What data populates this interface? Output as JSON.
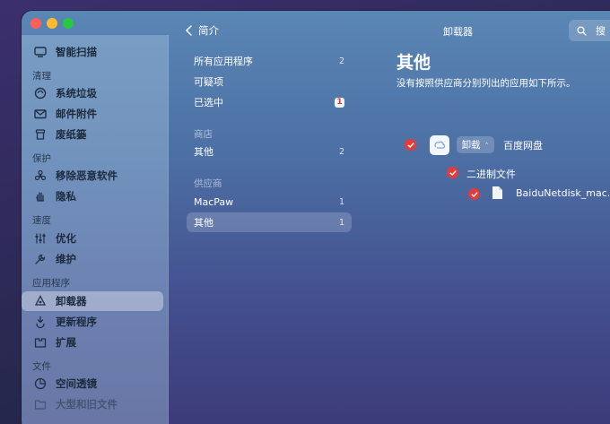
{
  "sidebar": {
    "items": [
      {
        "label": "智能扫描",
        "icon": "monitor-icon"
      },
      {
        "label": "系统垃圾",
        "icon": "trash-cycle-icon"
      },
      {
        "label": "邮件附件",
        "icon": "mail-icon"
      },
      {
        "label": "废纸篓",
        "icon": "trash-bin-icon"
      },
      {
        "label": "移除恶意软件",
        "icon": "biohazard-icon"
      },
      {
        "label": "隐私",
        "icon": "hand-icon"
      },
      {
        "label": "优化",
        "icon": "sliders-icon"
      },
      {
        "label": "维护",
        "icon": "wrench-icon"
      },
      {
        "label": "卸载器",
        "icon": "apps-icon"
      },
      {
        "label": "更新程序",
        "icon": "update-icon"
      },
      {
        "label": "扩展",
        "icon": "extension-icon"
      },
      {
        "label": "空间透镜",
        "icon": "lens-icon"
      },
      {
        "label": "大型和旧文件",
        "icon": "folder-icon"
      }
    ],
    "sections": [
      "清理",
      "保护",
      "速度",
      "应用程序",
      "文件"
    ]
  },
  "middle": {
    "back_label": "简介",
    "items": [
      {
        "label": "所有应用程序",
        "count": "2"
      },
      {
        "label": "可疑项",
        "count": ""
      },
      {
        "label": "已选中",
        "count": "1"
      },
      {
        "label": "其他",
        "count": "2"
      },
      {
        "label": "MacPaw",
        "count": "1"
      },
      {
        "label": "其他",
        "count": "1"
      }
    ],
    "sections": [
      "商店",
      "供应商"
    ]
  },
  "main": {
    "header": "卸载器",
    "search_placeholder": "搜",
    "title": "其他",
    "description": "没有按照供应商分别列出的应用如下所示。",
    "app": {
      "uninstall_label": "卸载",
      "name": "百度网盘",
      "binary_label": "二进制文件",
      "file_name": "BaiduNetdisk_mac.app"
    }
  },
  "colors": {
    "check_red": "#e23b3b",
    "traffic_red": "#ff5f57",
    "traffic_yellow": "#febc2e",
    "traffic_green": "#28c840"
  }
}
